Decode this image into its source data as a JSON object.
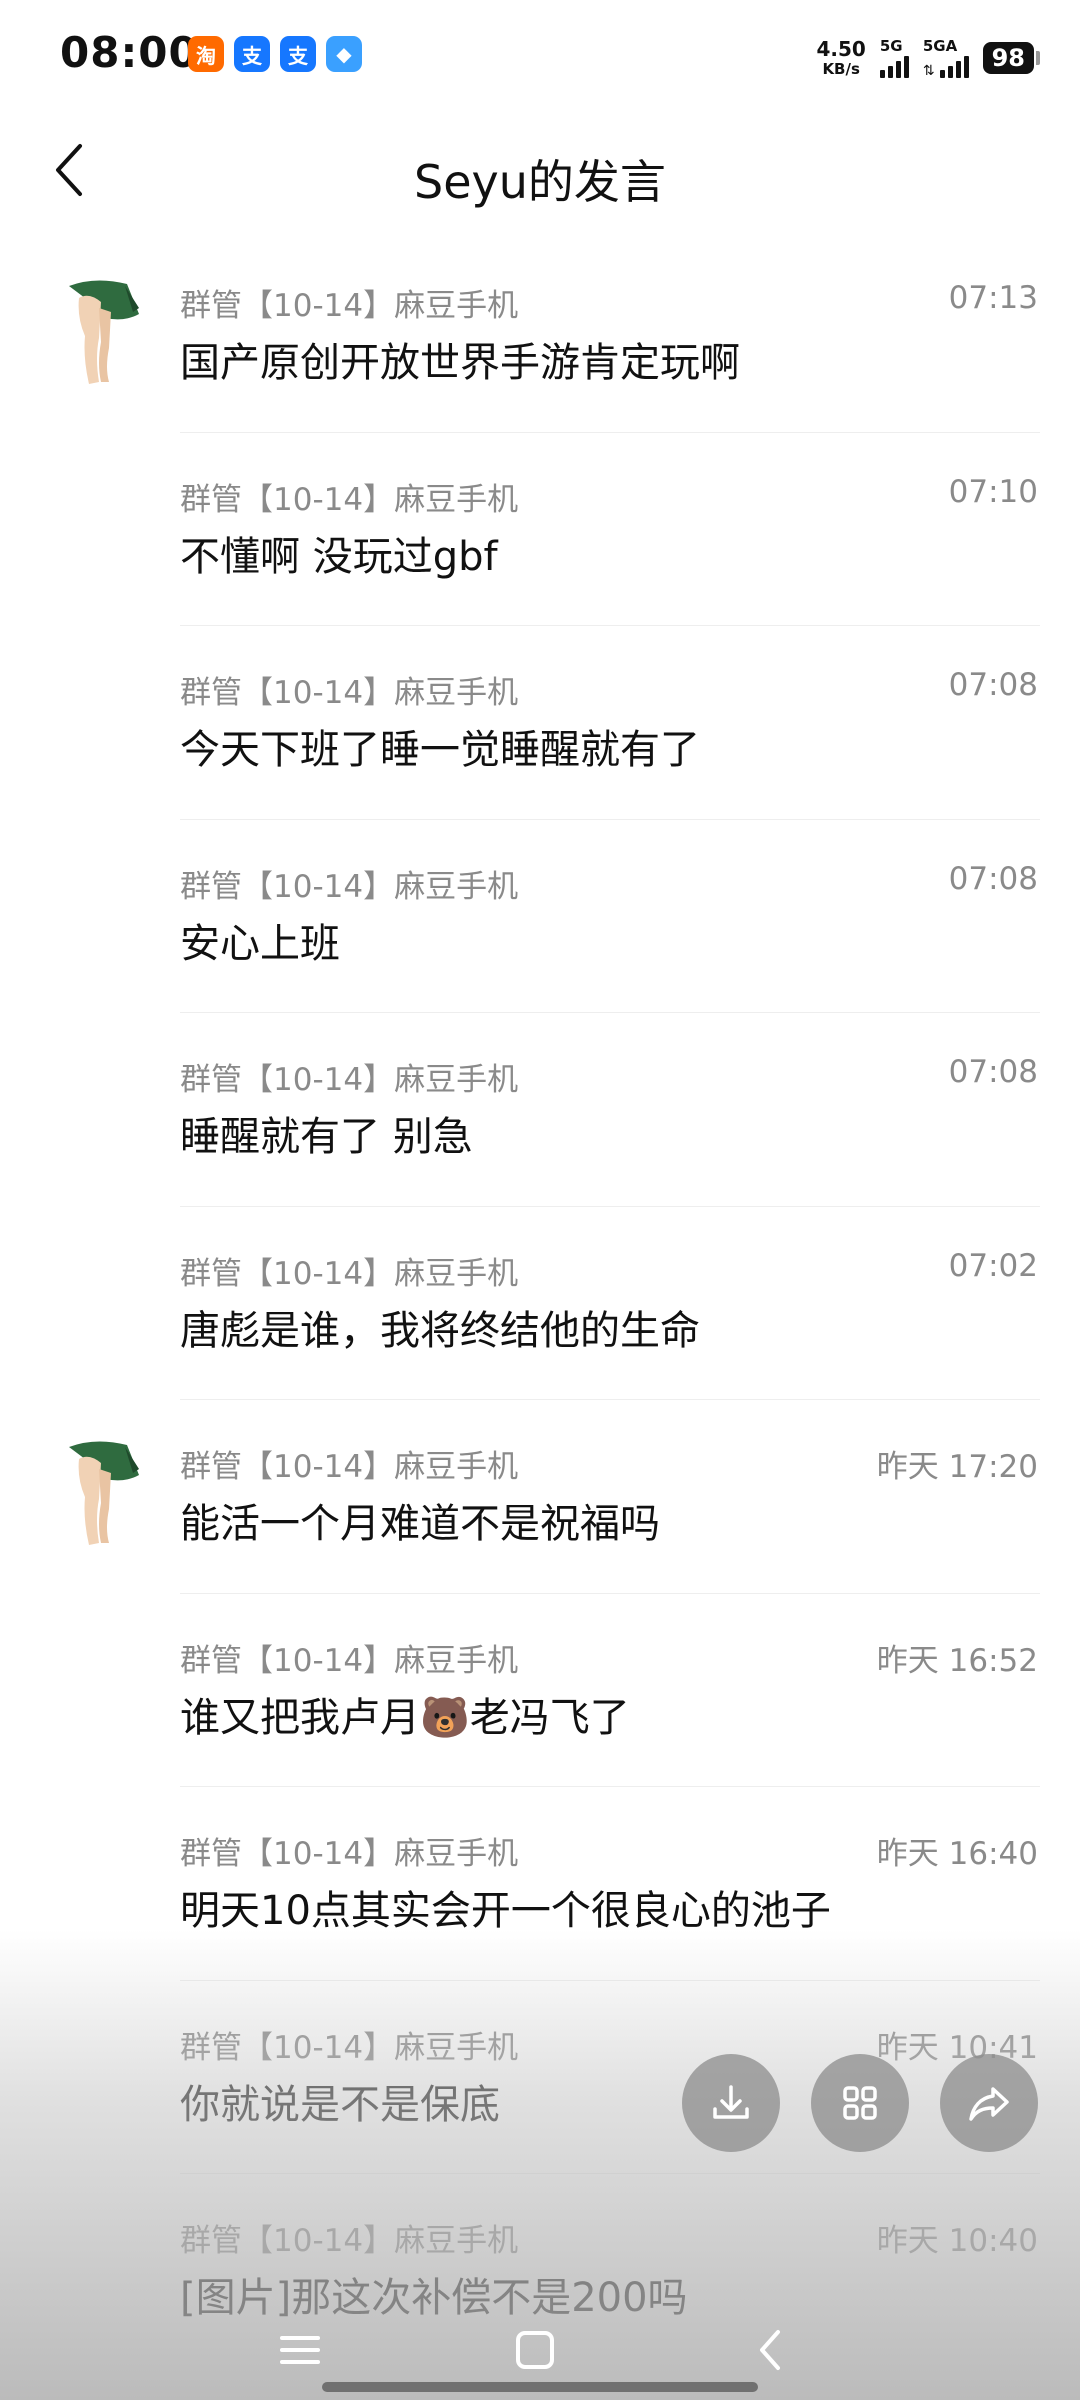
{
  "status_bar": {
    "time": "08:00",
    "net_speed_value": "4.50",
    "net_speed_unit": "KB/s",
    "signal1_label": "5G",
    "signal2_label": "5GA",
    "battery": "98",
    "app_icons": [
      {
        "name": "taobao-icon",
        "glyph": "淘",
        "color": "#ff6a00"
      },
      {
        "name": "alipay-icon",
        "glyph": "支",
        "color": "#1677ff"
      },
      {
        "name": "alipay-icon-2",
        "glyph": "支",
        "color": "#1677ff"
      },
      {
        "name": "app-icon",
        "glyph": "◆",
        "color": "#3aa0ff"
      }
    ]
  },
  "header": {
    "title": "Seyu的发言"
  },
  "messages": [
    {
      "sender": "群管【10-14】麻豆手机",
      "time": "07:13",
      "content": "国产原创开放世界手游肯定玩啊",
      "show_avatar": true
    },
    {
      "sender": "群管【10-14】麻豆手机",
      "time": "07:10",
      "content": "不懂啊 没玩过gbf",
      "show_avatar": false
    },
    {
      "sender": "群管【10-14】麻豆手机",
      "time": "07:08",
      "content": "今天下班了睡一觉睡醒就有了",
      "show_avatar": false
    },
    {
      "sender": "群管【10-14】麻豆手机",
      "time": "07:08",
      "content": "安心上班",
      "show_avatar": false
    },
    {
      "sender": "群管【10-14】麻豆手机",
      "time": "07:08",
      "content": "睡醒就有了 别急",
      "show_avatar": false
    },
    {
      "sender": "群管【10-14】麻豆手机",
      "time": "07:02",
      "content": "唐彪是谁，我将终结他的生命",
      "show_avatar": false
    },
    {
      "sender": "群管【10-14】麻豆手机",
      "time": "昨天 17:20",
      "content": "能活一个月难道不是祝福吗",
      "show_avatar": true
    },
    {
      "sender": "群管【10-14】麻豆手机",
      "time": "昨天 16:52",
      "content": "谁又把我卢月🐻老冯飞了",
      "show_avatar": false
    },
    {
      "sender": "群管【10-14】麻豆手机",
      "time": "昨天 16:40",
      "content": "明天10点其实会开一个很良心的池子",
      "show_avatar": false
    },
    {
      "sender": "群管【10-14】麻豆手机",
      "time": "昨天 10:41",
      "content": "你就说是不是保底",
      "show_avatar": false
    },
    {
      "sender": "群管【10-14】麻豆手机",
      "time": "昨天 10:40",
      "content": "[图片]那这次补偿不是200吗",
      "show_avatar": false
    }
  ],
  "fab_buttons": [
    {
      "name": "download-button",
      "icon": "download-icon"
    },
    {
      "name": "grid-button",
      "icon": "grid-icon"
    },
    {
      "name": "share-button",
      "icon": "share-icon"
    }
  ],
  "colors": {
    "meta_text": "#8a8a8a",
    "content_text": "#111111",
    "divider": "#eeeeee"
  }
}
